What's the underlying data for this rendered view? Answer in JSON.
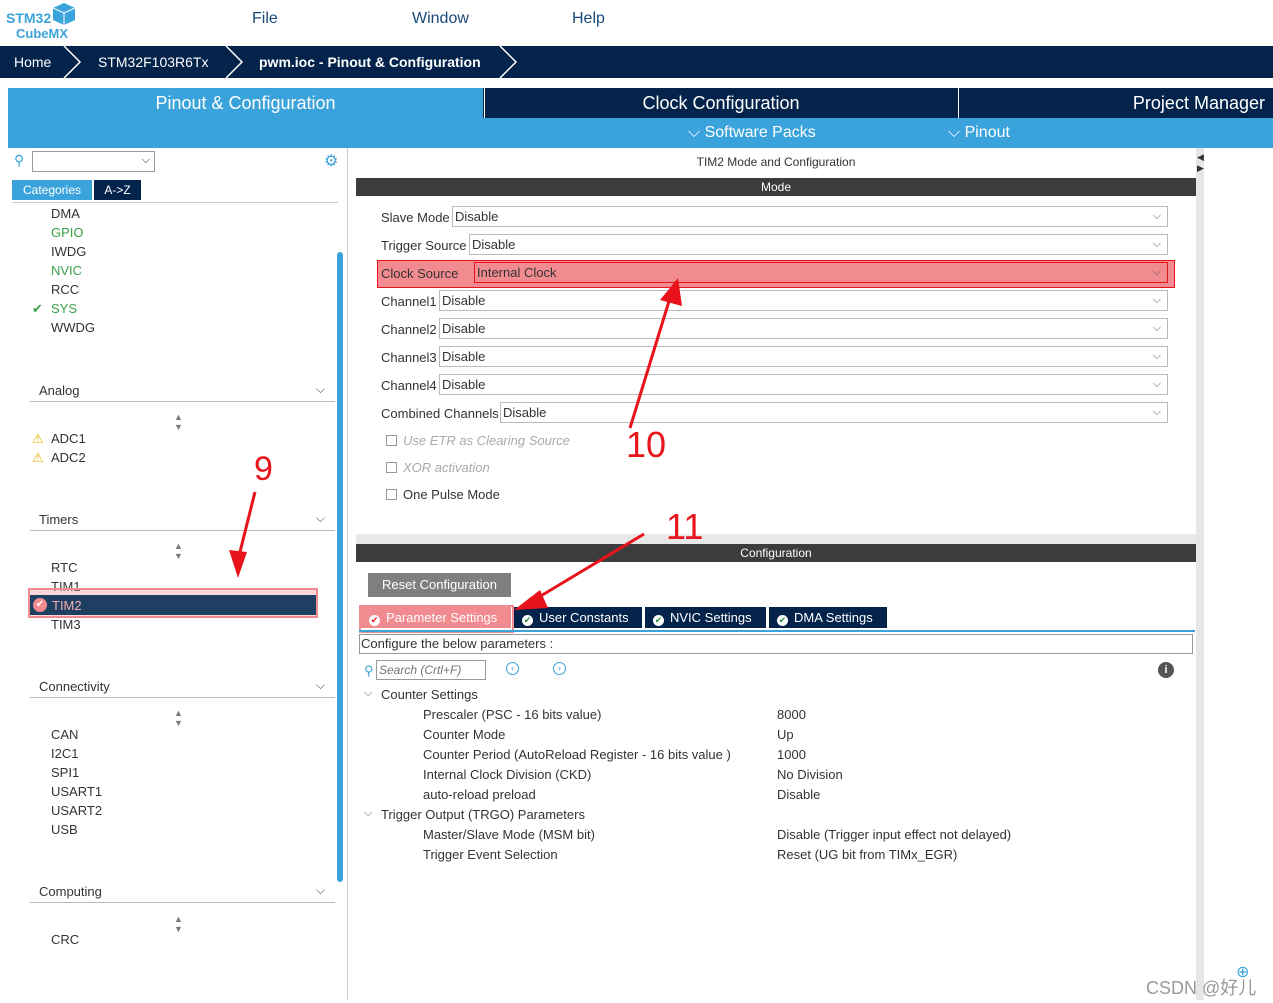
{
  "app": {
    "logo_top": "STM32",
    "logo_bottom": "CubeMX"
  },
  "menu": [
    "File",
    "Window",
    "Help"
  ],
  "breadcrumb": [
    "Home",
    "STM32F103R6Tx",
    "pwm.ioc - Pinout & Configuration"
  ],
  "tabs": [
    "Pinout & Configuration",
    "Clock Configuration",
    "Project Manager"
  ],
  "subbar": [
    "Software Packs",
    "Pinout"
  ],
  "left": {
    "search_value": "",
    "categories_btn": "Categories",
    "az_btn": "A->Z",
    "system_items": [
      {
        "label": "DMA",
        "color": "#333"
      },
      {
        "label": "GPIO",
        "color": "#3aa04a"
      },
      {
        "label": "IWDG",
        "color": "#333"
      },
      {
        "label": "NVIC",
        "color": "#3aa04a"
      },
      {
        "label": "RCC",
        "color": "#333"
      },
      {
        "label": "SYS",
        "color": "#3aa04a",
        "check": "✔"
      },
      {
        "label": "WWDG",
        "color": "#333"
      }
    ],
    "analog": {
      "title": "Analog",
      "items": [
        "ADC1",
        "ADC2"
      ]
    },
    "timers": {
      "title": "Timers",
      "items": [
        "RTC",
        "TIM1",
        "TIM2",
        "TIM3"
      ]
    },
    "connectivity": {
      "title": "Connectivity",
      "items": [
        "CAN",
        "I2C1",
        "SPI1",
        "USART1",
        "USART2",
        "USB"
      ]
    },
    "computing": {
      "title": "Computing",
      "items": [
        "CRC"
      ]
    }
  },
  "mode": {
    "title": "TIM2 Mode and Configuration",
    "header": "Mode",
    "rows": [
      {
        "label": "Slave Mode",
        "value": "Disable"
      },
      {
        "label": "Trigger Source",
        "value": "Disable"
      },
      {
        "label": "Clock Source",
        "value": "Internal Clock"
      },
      {
        "label": "Channel1",
        "value": "Disable"
      },
      {
        "label": "Channel2",
        "value": "Disable"
      },
      {
        "label": "Channel3",
        "value": "Disable"
      },
      {
        "label": "Channel4",
        "value": "Disable"
      },
      {
        "label": "Combined Channels",
        "value": "Disable"
      }
    ],
    "checks": [
      "Use ETR as Clearing Source",
      "XOR activation",
      "One Pulse Mode"
    ]
  },
  "config": {
    "header": "Configuration",
    "reset_btn": "Reset Configuration",
    "tabs": [
      "Parameter Settings",
      "User Constants",
      "NVIC Settings",
      "DMA Settings"
    ],
    "hint": "Configure the below parameters :",
    "search_placeholder": "Search (Crtl+F)",
    "group1": "Counter Settings",
    "params1": [
      {
        "name": "Prescaler (PSC - 16 bits value)",
        "value": "8000"
      },
      {
        "name": "Counter Mode",
        "value": "Up"
      },
      {
        "name": "Counter Period (AutoReload Register - 16 bits value )",
        "value": "1000"
      },
      {
        "name": "Internal Clock Division (CKD)",
        "value": "No Division"
      },
      {
        "name": "auto-reload preload",
        "value": "Disable"
      }
    ],
    "group2": "Trigger Output (TRGO) Parameters",
    "params2": [
      {
        "name": "Master/Slave Mode (MSM bit)",
        "value": "Disable (Trigger input effect not delayed)"
      },
      {
        "name": "Trigger Event Selection",
        "value": "Reset (UG bit from TIMx_EGR)"
      }
    ]
  },
  "annotations": [
    "9",
    "10",
    "11"
  ],
  "watermark": "CSDN @好儿",
  "colors": {
    "navy": "#03234b",
    "blue": "#3ba3db",
    "highlight": "#f28b8f",
    "arrow": "#e8131b"
  }
}
